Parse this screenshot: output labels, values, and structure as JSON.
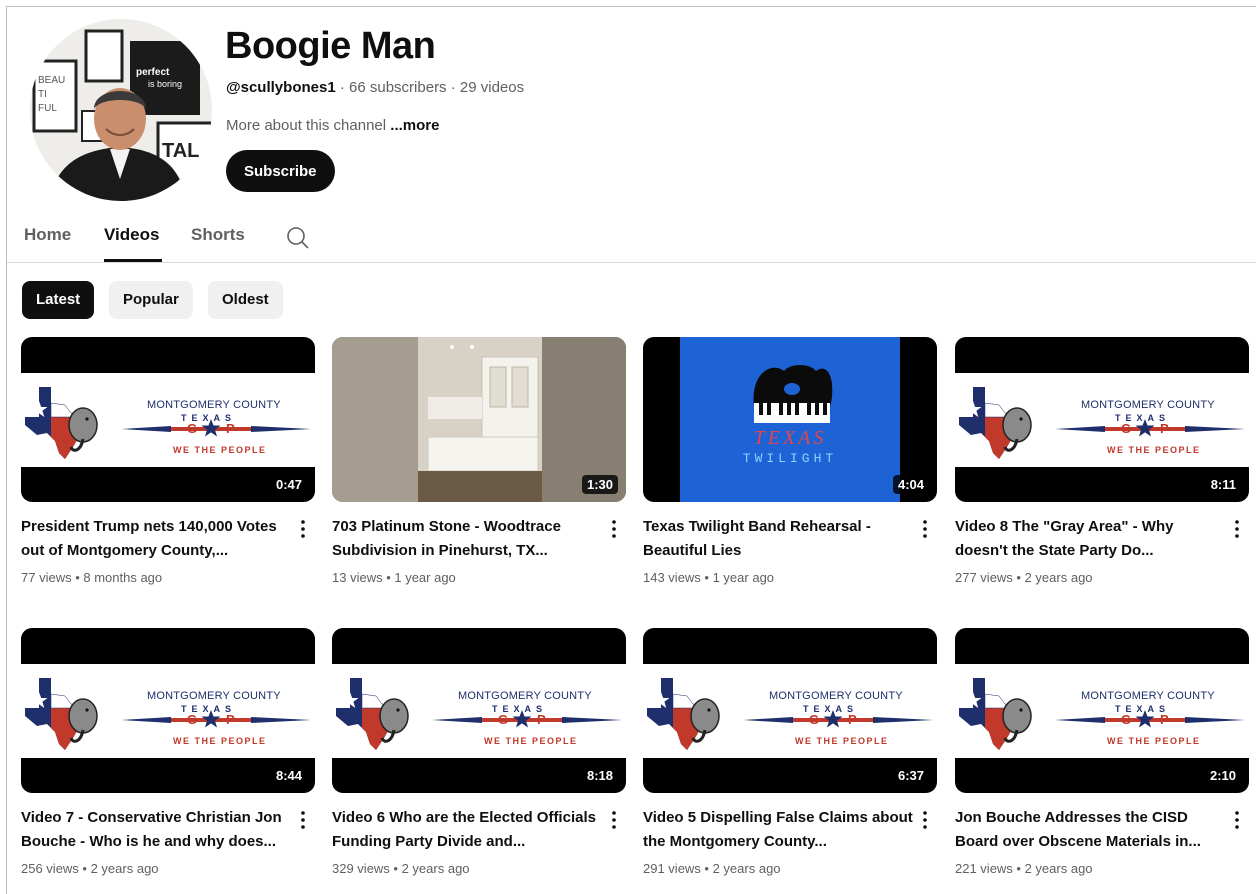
{
  "channel": {
    "name": "Boogie Man",
    "handle": "@scullybones1",
    "subscribers": "66 subscribers",
    "video_count": "29 videos",
    "separator": " · ",
    "about_prefix": "More about this channel ",
    "about_more": "...more",
    "subscribe_label": "Subscribe",
    "avatar_art_text": {
      "beautiful": "BEAU TI FUL",
      "perfect": "perfect is boring",
      "vital": "TAL"
    }
  },
  "tabs": [
    {
      "label": "Home",
      "active": false
    },
    {
      "label": "Videos",
      "active": true
    },
    {
      "label": "Shorts",
      "active": false
    }
  ],
  "chips": [
    {
      "label": "Latest",
      "active": true
    },
    {
      "label": "Popular",
      "active": false
    },
    {
      "label": "Oldest",
      "active": false
    }
  ],
  "gop_logo": {
    "line1": "MONTGOMERY COUNTY",
    "line2": "TEXAS",
    "line3": "WE THE PEOPLE",
    "g": "G",
    "p": "P"
  },
  "texas_twilight": {
    "line1": "TEXAS",
    "line2": "TWILIGHT"
  },
  "videos": [
    {
      "title": "President Trump nets 140,000 Votes out of Montgomery County,...",
      "views": "77 views",
      "age": "8 months ago",
      "duration": "0:47",
      "thumb": "gop"
    },
    {
      "title": "703 Platinum Stone - Woodtrace Subdivision in Pinehurst, TX...",
      "views": "13 views",
      "age": "1 year ago",
      "duration": "1:30",
      "thumb": "kitchen"
    },
    {
      "title": "Texas Twilight Band Rehearsal - Beautiful Lies",
      "views": "143 views",
      "age": "1 year ago",
      "duration": "4:04",
      "thumb": "twilight"
    },
    {
      "title": "Video 8 The \"Gray Area\" - Why doesn't the State Party Do...",
      "views": "277 views",
      "age": "2 years ago",
      "duration": "8:11",
      "thumb": "gop"
    },
    {
      "title": "Video 7 - Conservative Christian Jon Bouche - Who is he and why does...",
      "views": "256 views",
      "age": "2 years ago",
      "duration": "8:44",
      "thumb": "gop"
    },
    {
      "title": "Video 6 Who are the Elected Officials Funding Party Divide and...",
      "views": "329 views",
      "age": "2 years ago",
      "duration": "8:18",
      "thumb": "gop"
    },
    {
      "title": "Video 5 Dispelling False Claims about the Montgomery County...",
      "views": "291 views",
      "age": "2 years ago",
      "duration": "6:37",
      "thumb": "gop"
    },
    {
      "title": "Jon Bouche Addresses the CISD Board over Obscene Materials in...",
      "views": "221 views",
      "age": "2 years ago",
      "duration": "2:10",
      "thumb": "gop"
    }
  ],
  "colors": {
    "text_primary": "#0f0f0f",
    "text_secondary": "#606060",
    "chip_bg": "#f0f0f0",
    "gop_navy": "#1e2f6b",
    "gop_red": "#c0392b",
    "twilight_blue": "#1e63d6"
  }
}
